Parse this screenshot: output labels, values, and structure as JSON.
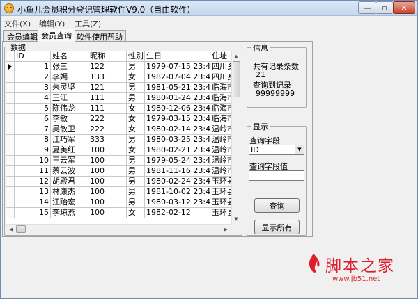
{
  "window": {
    "title": "小鱼儿会员积分登记管理软件V9.0（自由软件）",
    "min_glyph": "—",
    "max_glyph": "▫",
    "close_glyph": "✕"
  },
  "menu": [
    "文件(X)",
    "编辑(Y)",
    "工具(Z)"
  ],
  "tabs": [
    "会员编辑",
    "会员查询",
    "软件使用帮助"
  ],
  "data_group": {
    "label": "数据",
    "columns": [
      "ID",
      "姓名",
      "昵称",
      "性别",
      "生日",
      "住址"
    ],
    "rows": [
      [
        "1",
        "张三",
        "122",
        "男",
        "1979-07-15 23:45:40",
        "四川乡"
      ],
      [
        "2",
        "李嫣",
        "133",
        "女",
        "1982-07-04 23:45:40",
        "四川乡"
      ],
      [
        "3",
        "朱灵坚",
        "121",
        "男",
        "1981-05-21 23:45:40",
        "临海市"
      ],
      [
        "4",
        "王江",
        "111",
        "男",
        "1980-01-24 23:45:40",
        "临海市"
      ],
      [
        "5",
        "陈伟龙",
        "111",
        "女",
        "1980-12-06 23:45:40",
        "临海市"
      ],
      [
        "6",
        "李敏",
        "222",
        "女",
        "1979-03-15 23:45:40",
        "临海市"
      ],
      [
        "7",
        "吴敏卫",
        "222",
        "女",
        "1980-02-14 23:45:40",
        "温岭市"
      ],
      [
        "8",
        "江巧军",
        "333",
        "男",
        "1980-03-25 23:45:40",
        "温岭市"
      ],
      [
        "9",
        "夏美红",
        "100",
        "女",
        "1980-02-21 23:45:40",
        "温岭市"
      ],
      [
        "10",
        "王云军",
        "100",
        "男",
        "1979-05-24 23:45:40",
        "温岭市"
      ],
      [
        "11",
        "蔡云波",
        "100",
        "男",
        "1981-11-16 23:45:40",
        "温岭市"
      ],
      [
        "12",
        "胡殿君",
        "100",
        "男",
        "1980-02-24 23:45:40",
        "玉环县"
      ],
      [
        "13",
        "林康杰",
        "100",
        "男",
        "1981-10-02 23:45:40",
        "玉环县"
      ],
      [
        "14",
        "江贻宏",
        "100",
        "男",
        "1980-03-12 23:45:40",
        "玉环县"
      ],
      [
        "15",
        "李琼燕",
        "100",
        "女",
        "1982-02-12",
        "玉环县"
      ]
    ]
  },
  "info_group": {
    "label": "信息",
    "total_label": "共有记录条数",
    "total_value": "21",
    "found_label": "查询到记录",
    "found_value": "99999999"
  },
  "display_group": {
    "label": "显示",
    "field_label": "查询字段",
    "field_selected": "ID",
    "value_label": "查询字段值",
    "value_input": "",
    "query_button": "查询",
    "show_all_button": "显示所有"
  },
  "watermark": {
    "main": "脚本之家",
    "sub": "www.jb51.net"
  }
}
